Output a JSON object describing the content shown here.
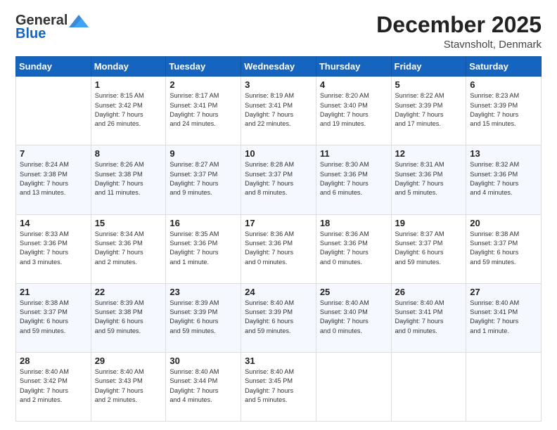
{
  "header": {
    "logo_general": "General",
    "logo_blue": "Blue",
    "month": "December 2025",
    "location": "Stavnsholt, Denmark"
  },
  "weekdays": [
    "Sunday",
    "Monday",
    "Tuesday",
    "Wednesday",
    "Thursday",
    "Friday",
    "Saturday"
  ],
  "weeks": [
    [
      {
        "day": "",
        "info": ""
      },
      {
        "day": "1",
        "info": "Sunrise: 8:15 AM\nSunset: 3:42 PM\nDaylight: 7 hours\nand 26 minutes."
      },
      {
        "day": "2",
        "info": "Sunrise: 8:17 AM\nSunset: 3:41 PM\nDaylight: 7 hours\nand 24 minutes."
      },
      {
        "day": "3",
        "info": "Sunrise: 8:19 AM\nSunset: 3:41 PM\nDaylight: 7 hours\nand 22 minutes."
      },
      {
        "day": "4",
        "info": "Sunrise: 8:20 AM\nSunset: 3:40 PM\nDaylight: 7 hours\nand 19 minutes."
      },
      {
        "day": "5",
        "info": "Sunrise: 8:22 AM\nSunset: 3:39 PM\nDaylight: 7 hours\nand 17 minutes."
      },
      {
        "day": "6",
        "info": "Sunrise: 8:23 AM\nSunset: 3:39 PM\nDaylight: 7 hours\nand 15 minutes."
      }
    ],
    [
      {
        "day": "7",
        "info": "Sunrise: 8:24 AM\nSunset: 3:38 PM\nDaylight: 7 hours\nand 13 minutes."
      },
      {
        "day": "8",
        "info": "Sunrise: 8:26 AM\nSunset: 3:38 PM\nDaylight: 7 hours\nand 11 minutes."
      },
      {
        "day": "9",
        "info": "Sunrise: 8:27 AM\nSunset: 3:37 PM\nDaylight: 7 hours\nand 9 minutes."
      },
      {
        "day": "10",
        "info": "Sunrise: 8:28 AM\nSunset: 3:37 PM\nDaylight: 7 hours\nand 8 minutes."
      },
      {
        "day": "11",
        "info": "Sunrise: 8:30 AM\nSunset: 3:36 PM\nDaylight: 7 hours\nand 6 minutes."
      },
      {
        "day": "12",
        "info": "Sunrise: 8:31 AM\nSunset: 3:36 PM\nDaylight: 7 hours\nand 5 minutes."
      },
      {
        "day": "13",
        "info": "Sunrise: 8:32 AM\nSunset: 3:36 PM\nDaylight: 7 hours\nand 4 minutes."
      }
    ],
    [
      {
        "day": "14",
        "info": "Sunrise: 8:33 AM\nSunset: 3:36 PM\nDaylight: 7 hours\nand 3 minutes."
      },
      {
        "day": "15",
        "info": "Sunrise: 8:34 AM\nSunset: 3:36 PM\nDaylight: 7 hours\nand 2 minutes."
      },
      {
        "day": "16",
        "info": "Sunrise: 8:35 AM\nSunset: 3:36 PM\nDaylight: 7 hours\nand 1 minute."
      },
      {
        "day": "17",
        "info": "Sunrise: 8:36 AM\nSunset: 3:36 PM\nDaylight: 7 hours\nand 0 minutes."
      },
      {
        "day": "18",
        "info": "Sunrise: 8:36 AM\nSunset: 3:36 PM\nDaylight: 7 hours\nand 0 minutes."
      },
      {
        "day": "19",
        "info": "Sunrise: 8:37 AM\nSunset: 3:37 PM\nDaylight: 6 hours\nand 59 minutes."
      },
      {
        "day": "20",
        "info": "Sunrise: 8:38 AM\nSunset: 3:37 PM\nDaylight: 6 hours\nand 59 minutes."
      }
    ],
    [
      {
        "day": "21",
        "info": "Sunrise: 8:38 AM\nSunset: 3:37 PM\nDaylight: 6 hours\nand 59 minutes."
      },
      {
        "day": "22",
        "info": "Sunrise: 8:39 AM\nSunset: 3:38 PM\nDaylight: 6 hours\nand 59 minutes."
      },
      {
        "day": "23",
        "info": "Sunrise: 8:39 AM\nSunset: 3:39 PM\nDaylight: 6 hours\nand 59 minutes."
      },
      {
        "day": "24",
        "info": "Sunrise: 8:40 AM\nSunset: 3:39 PM\nDaylight: 6 hours\nand 59 minutes."
      },
      {
        "day": "25",
        "info": "Sunrise: 8:40 AM\nSunset: 3:40 PM\nDaylight: 7 hours\nand 0 minutes."
      },
      {
        "day": "26",
        "info": "Sunrise: 8:40 AM\nSunset: 3:41 PM\nDaylight: 7 hours\nand 0 minutes."
      },
      {
        "day": "27",
        "info": "Sunrise: 8:40 AM\nSunset: 3:41 PM\nDaylight: 7 hours\nand 1 minute."
      }
    ],
    [
      {
        "day": "28",
        "info": "Sunrise: 8:40 AM\nSunset: 3:42 PM\nDaylight: 7 hours\nand 2 minutes."
      },
      {
        "day": "29",
        "info": "Sunrise: 8:40 AM\nSunset: 3:43 PM\nDaylight: 7 hours\nand 2 minutes."
      },
      {
        "day": "30",
        "info": "Sunrise: 8:40 AM\nSunset: 3:44 PM\nDaylight: 7 hours\nand 4 minutes."
      },
      {
        "day": "31",
        "info": "Sunrise: 8:40 AM\nSunset: 3:45 PM\nDaylight: 7 hours\nand 5 minutes."
      },
      {
        "day": "",
        "info": ""
      },
      {
        "day": "",
        "info": ""
      },
      {
        "day": "",
        "info": ""
      }
    ]
  ]
}
